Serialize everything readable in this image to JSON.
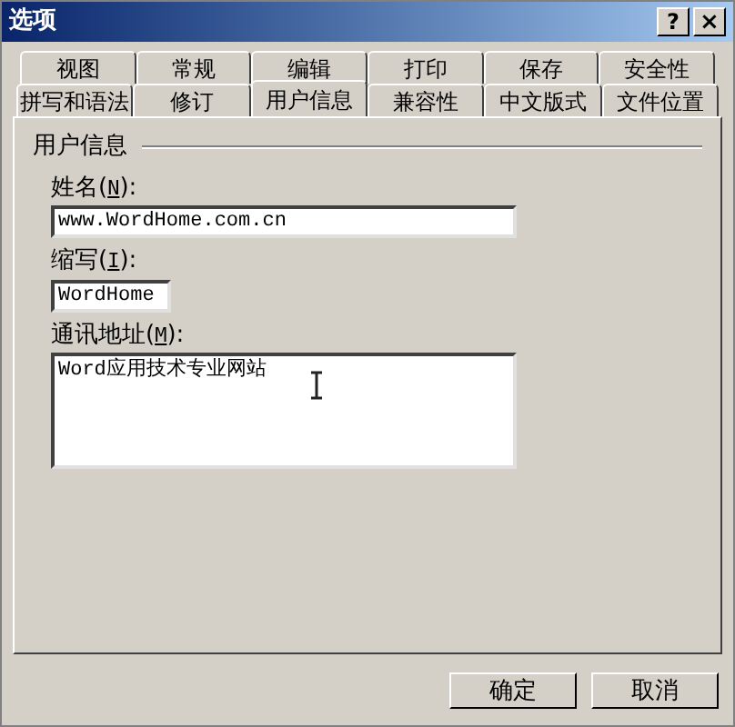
{
  "window": {
    "title": "选项",
    "help": "?",
    "close": "×"
  },
  "tab_rows": [
    {
      "tabs": [
        {
          "label": "视图",
          "selected": false
        },
        {
          "label": "常规",
          "selected": false
        },
        {
          "label": "编辑",
          "selected": false
        },
        {
          "label": "打印",
          "selected": false
        },
        {
          "label": "保存",
          "selected": false
        },
        {
          "label": "安全性",
          "selected": false
        }
      ]
    },
    {
      "tabs": [
        {
          "label": "拼写和语法",
          "selected": false
        },
        {
          "label": "修订",
          "selected": false
        },
        {
          "label": "用户信息",
          "selected": true
        },
        {
          "label": "兼容性",
          "selected": false
        },
        {
          "label": "中文版式",
          "selected": false
        },
        {
          "label": "文件位置",
          "selected": false
        }
      ]
    }
  ],
  "group": {
    "title": "用户信息"
  },
  "fields": [
    {
      "kind": "line",
      "label": "姓名(",
      "accel": "N",
      "suffix": "):",
      "value": "www.WordHome.com.cn"
    },
    {
      "kind": "short",
      "label": "缩写(",
      "accel": "I",
      "suffix": "):",
      "value": "WordHome"
    },
    {
      "kind": "area",
      "label": "通讯地址(",
      "accel": "M",
      "suffix": "):",
      "value": "Word应用技术专业网站"
    }
  ],
  "buttons": [
    "确定",
    "取消"
  ]
}
